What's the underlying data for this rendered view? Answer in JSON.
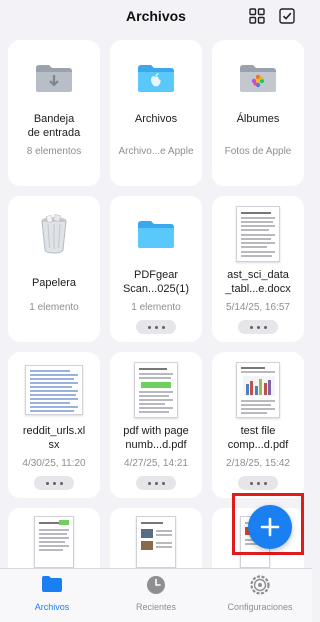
{
  "header": {
    "title": "Archivos",
    "grid_icon": "grid-view-icon",
    "select_icon": "select-checkbox-icon"
  },
  "items": [
    {
      "name": "Bandeja\nde entrada",
      "meta": "8 elementos",
      "icon": "inbox-folder-icon"
    },
    {
      "name": "Archivos",
      "meta": "Archivo...e Apple",
      "icon": "apple-folder-icon"
    },
    {
      "name": "Álbumes",
      "meta": "Fotos de Apple",
      "icon": "photos-folder-icon"
    },
    {
      "name": "Papelera",
      "meta": "1 elemento",
      "icon": "trash-icon"
    },
    {
      "name": "PDFgear\nScan...025(1)",
      "meta": "1 elemento",
      "icon": "folder-icon"
    },
    {
      "name": "ast_sci_data\n_tabl...e.docx",
      "meta": "5/14/25, 16:57",
      "icon": "document-thumbnail"
    },
    {
      "name": "reddit_urls.xl\nsx",
      "meta": "4/30/25, 11:20",
      "icon": "spreadsheet-thumbnail"
    },
    {
      "name": "pdf with page\nnumb...d.pdf",
      "meta": "4/27/25, 14:21",
      "icon": "pdf-thumbnail"
    },
    {
      "name": "test file\ncomp...d.pdf",
      "meta": "2/18/25, 15:42",
      "icon": "pdf-chart-thumbnail"
    }
  ],
  "tabs": [
    {
      "label": "Archivos",
      "icon": "folder-tab-icon",
      "active": true
    },
    {
      "label": "Recientes",
      "icon": "clock-icon",
      "active": false
    },
    {
      "label": "Configuraciones",
      "icon": "gear-icon",
      "active": false
    }
  ],
  "fab": {
    "icon": "plus-icon"
  },
  "colors": {
    "accent": "#1a7ff0",
    "folder": "#5ac8fa",
    "highlight_border": "#e01b1b"
  }
}
